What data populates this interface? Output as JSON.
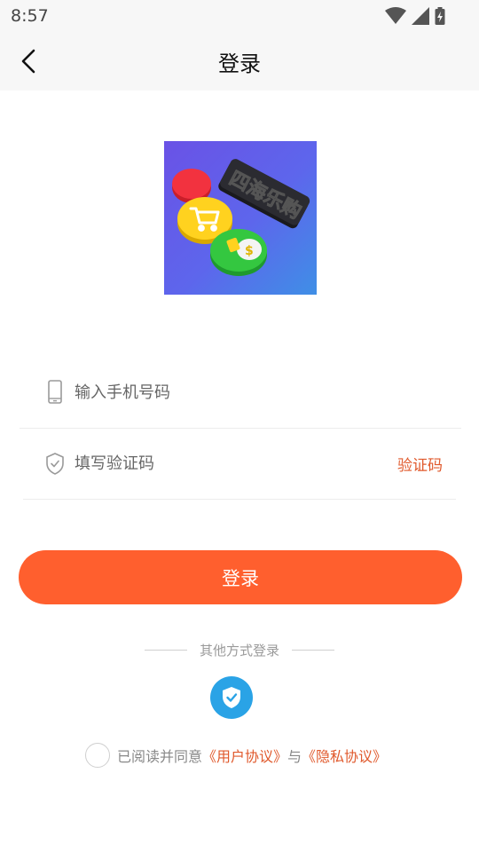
{
  "status_bar": {
    "time": "8:57",
    "icons": [
      "wifi-icon",
      "cell-signal-icon",
      "battery-charging-icon"
    ]
  },
  "nav": {
    "title": "登录",
    "back_icon": "chevron-left-icon"
  },
  "form": {
    "phone_placeholder": "输入手机号码",
    "phone_icon": "mobile-phone-icon",
    "code_placeholder": "填写验证码",
    "code_icon": "shield-icon",
    "code_button": "验证码"
  },
  "login_button": "登录",
  "other_login": {
    "label": "其他方式登录",
    "icon": "shield-check-icon"
  },
  "agreement": {
    "prefix": "已阅读并同意",
    "user_agreement": "《用户协议》",
    "connector": "与",
    "privacy_agreement": "《隐私协议》"
  },
  "colors": {
    "accent": "#ff5f2e",
    "link": "#e0592c",
    "alt_login_bg": "#2aa3e6",
    "bar_bg": "#f7f7f7"
  }
}
